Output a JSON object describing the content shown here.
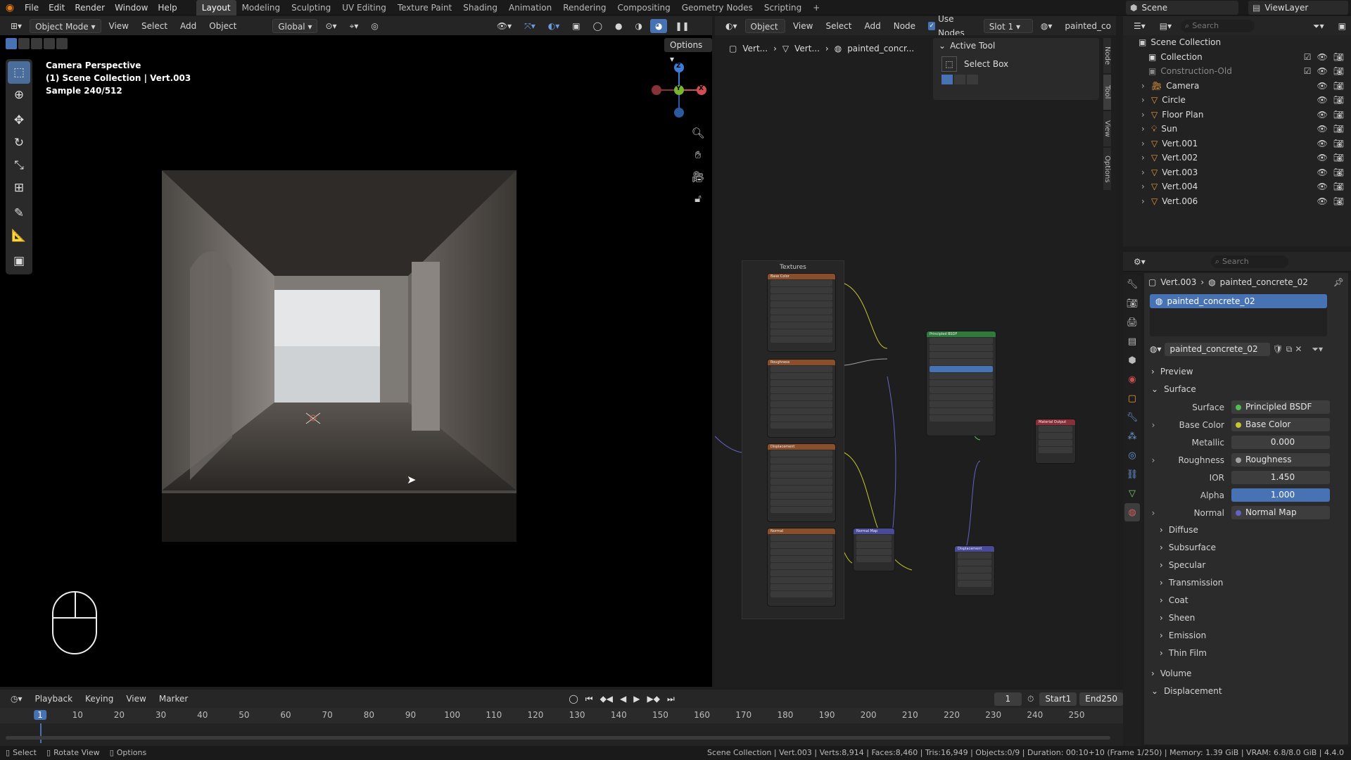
{
  "menu": [
    "File",
    "Edit",
    "Render",
    "Window",
    "Help"
  ],
  "workspaces": [
    "Layout",
    "Modeling",
    "Sculpting",
    "UV Editing",
    "Texture Paint",
    "Shading",
    "Animation",
    "Rendering",
    "Compositing",
    "Geometry Nodes",
    "Scripting"
  ],
  "top_right": {
    "scene": "Scene",
    "view_layer": "ViewLayer",
    "search": "Search"
  },
  "viewport_header": {
    "mode": "Object Mode",
    "view": "View",
    "select": "Select",
    "add": "Add",
    "object": "Object",
    "orientation": "Global",
    "options": "Options"
  },
  "viewport_overlay": {
    "line1": "Camera Perspective",
    "line2": "(1) Scene Collection | Vert.003",
    "line3": "Sample 240/512"
  },
  "gizmo": {
    "z": "Z",
    "y": "Y",
    "x": "X"
  },
  "node_header": {
    "object": "Object",
    "view": "View",
    "select": "Select",
    "add": "Add",
    "node": "Node",
    "use_nodes": "Use Nodes",
    "slot": "Slot 1",
    "material": "painted_co"
  },
  "node_breadcrumb": [
    "Vert...",
    "Vert...",
    "painted_concr..."
  ],
  "active_tool": {
    "title": "Active Tool",
    "tool": "Select Box"
  },
  "side_tabs": [
    "Node",
    "Tool",
    "View",
    "Options"
  ],
  "node_graph": {
    "frame": "Textures",
    "tex_nodes": [
      "Base Color",
      "Roughness",
      "Displacement",
      "Normal"
    ],
    "bsdf": "Principled BSDF",
    "output": "Material Output",
    "normal_map": "Normal Map",
    "displacement": "Displacement"
  },
  "outliner": {
    "root": "Scene Collection",
    "items": [
      {
        "name": "Collection",
        "type": "collection"
      },
      {
        "name": "Construction-Old",
        "type": "collection-off"
      },
      {
        "name": "Camera",
        "type": "camera"
      },
      {
        "name": "Circle",
        "type": "mesh"
      },
      {
        "name": "Floor Plan",
        "type": "mesh"
      },
      {
        "name": "Sun",
        "type": "light"
      },
      {
        "name": "Vert.001",
        "type": "mesh"
      },
      {
        "name": "Vert.002",
        "type": "mesh"
      },
      {
        "name": "Vert.003",
        "type": "mesh"
      },
      {
        "name": "Vert.004",
        "type": "mesh"
      },
      {
        "name": "Vert.006",
        "type": "mesh"
      }
    ]
  },
  "properties": {
    "search": "Search",
    "breadcrumb_obj": "Vert.003",
    "breadcrumb_mat": "painted_concrete_02",
    "slot_name": "painted_concrete_02",
    "material_name": "painted_concrete_02",
    "preview": "Preview",
    "surface": "Surface",
    "rows": [
      {
        "label": "Surface",
        "value": "Principled BSDF",
        "kind": "link-green"
      },
      {
        "label": "Base Color",
        "value": "Base Color",
        "kind": "link-yellow"
      },
      {
        "label": "Metallic",
        "value": "0.000",
        "kind": "field"
      },
      {
        "label": "Roughness",
        "value": "Roughness",
        "kind": "link-gray"
      },
      {
        "label": "IOR",
        "value": "1.450",
        "kind": "field"
      },
      {
        "label": "Alpha",
        "value": "1.000",
        "kind": "blue"
      },
      {
        "label": "Normal",
        "value": "Normal Map",
        "kind": "link-purple"
      }
    ],
    "subsections": [
      "Diffuse",
      "Subsurface",
      "Specular",
      "Transmission",
      "Coat",
      "Sheen",
      "Emission",
      "Thin Film"
    ],
    "volume": "Volume",
    "displacement": "Displacement"
  },
  "timeline": {
    "playback": "Playback",
    "keying": "Keying",
    "view": "View",
    "marker": "Marker",
    "current_frame": "1",
    "start_label": "Start",
    "start": "1",
    "end_label": "End",
    "end": "250",
    "ticks": [
      "1",
      "10",
      "20",
      "30",
      "40",
      "50",
      "60",
      "70",
      "80",
      "90",
      "100",
      "110",
      "120",
      "130",
      "140",
      "150",
      "160",
      "170",
      "180",
      "190",
      "200",
      "210",
      "220",
      "230",
      "240",
      "250"
    ]
  },
  "statusbar": {
    "select": "Select",
    "rotate": "Rotate View",
    "options": "Options",
    "info": "Scene Collection | Vert.003 | Verts:8,914 | Faces:8,460 | Tris:16,949 | Objects:0/9 | Duration: 00:10+10 (Frame 1/250) | Memory: 1.39 GiB | VRAM: 6.8/8.0 GiB | 4.4.0"
  },
  "colors": {
    "accent": "#4772b3",
    "active_tab": "#3a3a3a"
  }
}
